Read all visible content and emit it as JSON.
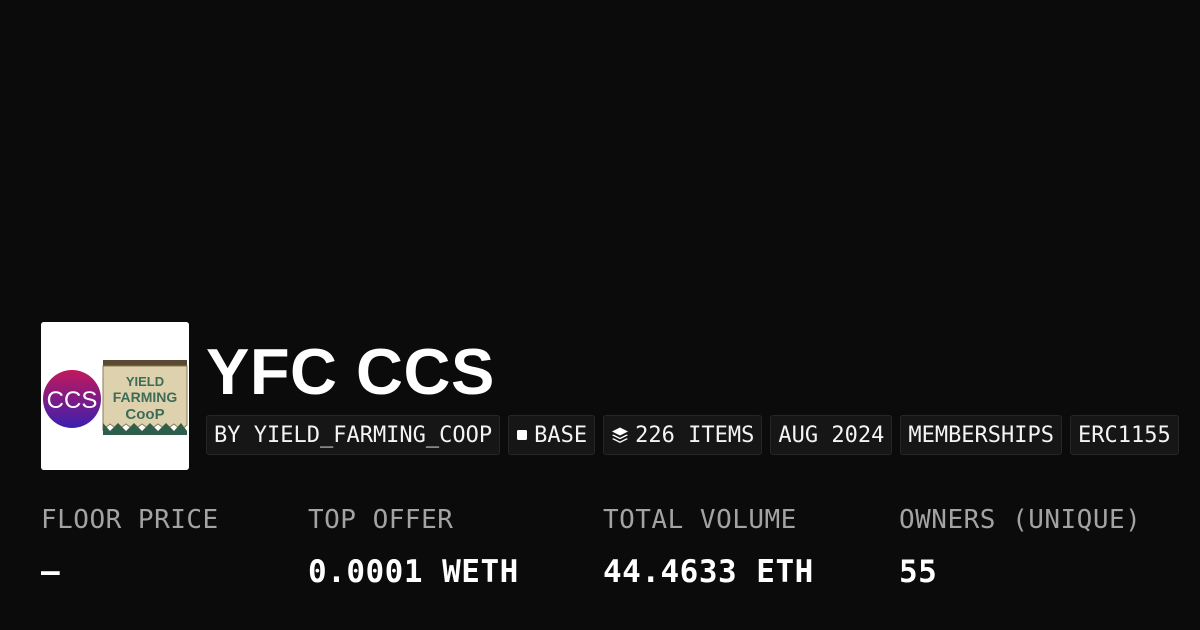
{
  "collection": {
    "title": "YFC CCS",
    "logo": {
      "badge_text": "CCS",
      "banner_lines": [
        "YIELD",
        "FARMING",
        "CooP"
      ]
    }
  },
  "chips": [
    {
      "label": "BY YIELD_FARMING_COOP",
      "icon": ""
    },
    {
      "label": "BASE",
      "icon": "square-icon"
    },
    {
      "label": "226 ITEMS",
      "icon": "layers-icon"
    },
    {
      "label": "AUG 2024",
      "icon": ""
    },
    {
      "label": "MEMBERSHIPS",
      "icon": ""
    },
    {
      "label": "ERC1155",
      "icon": ""
    }
  ],
  "stats": [
    {
      "label": "FLOOR PRICE",
      "value": "–"
    },
    {
      "label": "TOP OFFER",
      "value": "0.0001 WETH"
    },
    {
      "label": "TOTAL VOLUME",
      "value": "44.4633 ETH"
    },
    {
      "label": "OWNERS (UNIQUE)",
      "value": "55"
    }
  ],
  "colors": {
    "background": "#0b0b0b",
    "chip_background": "#161616",
    "label_gray": "#a3a3a3",
    "badge_gradient_start": "#c2185b",
    "badge_gradient_end": "#3a1fb0",
    "banner_cloth": "#ddd2ad",
    "banner_text": "#3d6b56"
  }
}
